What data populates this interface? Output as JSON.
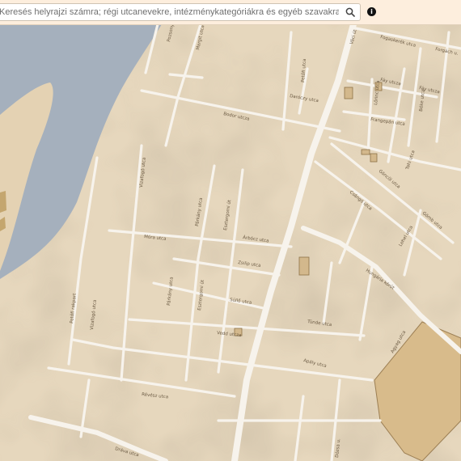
{
  "search": {
    "placeholder": "Keresés helyrajzi számra; régi utcanevekre, intézménykategóriákra és egyéb szavakra"
  },
  "icons": {
    "search": "search-icon",
    "info": "info-icon"
  },
  "colors": {
    "land": "#e6d7bd",
    "water": "#a5b0bd",
    "road": "#f7f3ec",
    "building": "#d3b88c",
    "park": "#d8bb8b"
  },
  "streets": [
    "Fogaskerék utca",
    "Forgách u.",
    "Fáy utcza",
    "Fáy utcza",
    "Lőrinc utca",
    "Frangepán utca",
    "Béke utca",
    "Váci út",
    "Petőfi utca",
    "Daróczy utca",
    "Bodor utcza",
    "Pozsonyi út",
    "Margit utca",
    "Vizafogó utca",
    "Göncöl utca",
    "Tahi utca",
    "Csángó utca",
    "Gömb utca",
    "Lehel utca",
    "Móra utca",
    "Párkány utca",
    "Esztergomi út",
    "Árbócz utca",
    "Zsilip utca",
    "Hungária körút",
    "Petőfi rakpart",
    "Vizafogó utca",
    "Párkány utca",
    "Esztergomi út",
    "Süllő utca",
    "Tünde utca",
    "Vedd utcza",
    "Apály utca",
    "Agyag utca",
    "Révész utca",
    "Dráva utca",
    "Dózsa u."
  ]
}
